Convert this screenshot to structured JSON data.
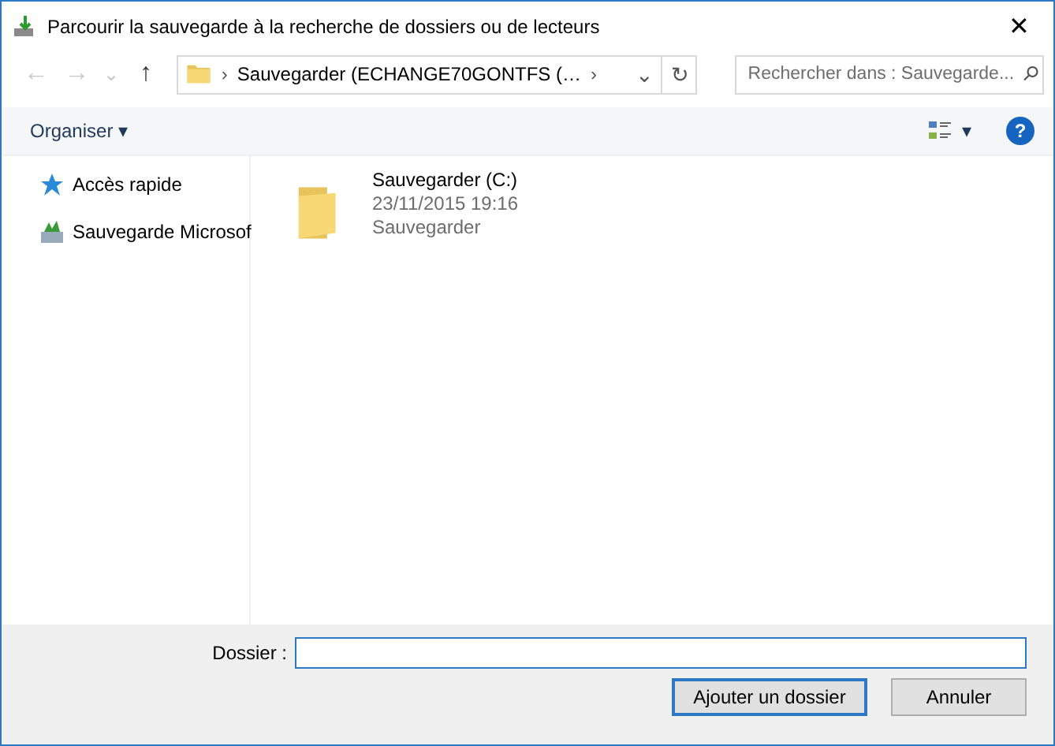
{
  "window": {
    "title": "Parcourir la sauvegarde à la recherche de dossiers ou de lecteurs",
    "close": "✕"
  },
  "nav": {
    "back": "←",
    "forward": "→",
    "recent": "⌄",
    "up": "↑",
    "path": [
      "›",
      "Sauvegarder (ECHANGE70GONTFS (…",
      "›"
    ],
    "history": "⌄",
    "refresh": "↻",
    "search": {
      "placeholder": "Rechercher dans : Sauvegarde..."
    }
  },
  "toolbar": {
    "organize": "Organiser",
    "organize_caret": "▾",
    "view_caret": "▾",
    "help": "?"
  },
  "sidebar": {
    "items": [
      {
        "kind": "star",
        "label": "Accès rapide"
      },
      {
        "kind": "backup",
        "label": "Sauvegarde Microsof"
      }
    ]
  },
  "items": [
    {
      "name": "Sauvegarder (C:)",
      "date": "23/11/2015 19:16",
      "type": "Sauvegarder"
    }
  ],
  "footer": {
    "folder_label": "Dossier :",
    "buttons": [
      {
        "label": "Ajouter un dossier",
        "default": true
      },
      {
        "label": "Annuler",
        "default": false
      }
    ]
  }
}
